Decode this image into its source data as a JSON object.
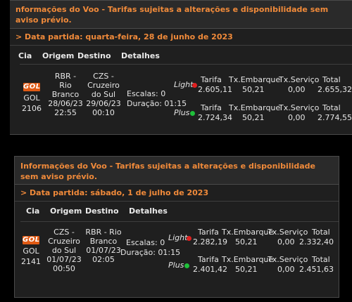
{
  "panels": [
    {
      "header": "nformações do Voo - Tarifas sujeitas a alterações e disponibilidade sem aviso prévio.",
      "date": "> Data partida: quarta-feira, 28 de junho de 2023",
      "columns": {
        "cia": "Cia",
        "origem": "Origem",
        "destino": "Destino",
        "detalhes": "Detalhes"
      },
      "flight": {
        "airline_logo": "GOL",
        "airline": "GOL",
        "number": "2106",
        "origin": [
          "RBR -",
          "Rio",
          "Branco",
          "28/06/23",
          "22:55"
        ],
        "destination": [
          "CZS -",
          "Cruzeiro",
          "do Sul",
          "29/06/23",
          "00:10"
        ],
        "stops": "Escalas: 0",
        "duration": "Duração: 01:15",
        "fare_headers": {
          "tarifa": "Tarifa",
          "embarque": "Tx.Embarque",
          "servico": "Tx.Serviço",
          "total": "Total"
        },
        "fares": [
          {
            "name": "Light",
            "dot_color": "#e02020",
            "tarifa": "2.605,11",
            "embarque": "50,21",
            "servico": "0,00",
            "total": "2.655,32"
          },
          {
            "name": "Plus",
            "dot_color": "#1fbf3a",
            "tarifa": "2.724,34",
            "embarque": "50,21",
            "servico": "0,00",
            "total": "2.774,55"
          }
        ]
      }
    },
    {
      "header": "Informações do Voo - Tarifas sujeitas a alterações e disponibilidade sem aviso prévio.",
      "date": "> Data partida: sábado, 1 de julho de 2023",
      "columns": {
        "cia": "Cia",
        "origem": "Origem",
        "destino": "Destino",
        "detalhes": "Detalhes"
      },
      "flight": {
        "airline_logo": "GOL",
        "airline": "GOL",
        "number": "2141",
        "origin": [
          "CZS -",
          "Cruzeiro",
          "do Sul",
          "01/07/23",
          "00:50"
        ],
        "destination": [
          "RBR - Rio",
          "Branco",
          "01/07/23",
          "02:05"
        ],
        "stops": "Escalas: 0",
        "duration": "Duração: 01:15",
        "fare_headers": {
          "tarifa": "Tarifa",
          "embarque": "Tx.Embarque",
          "servico": "Tx.Serviço",
          "total": "Total"
        },
        "fares": [
          {
            "name": "Light",
            "dot_color": "#e02020",
            "tarifa": "2.282,19",
            "embarque": "50,21",
            "servico": "0,00",
            "total": "2.332,40"
          },
          {
            "name": "Plus",
            "dot_color": "#1fbf3a",
            "tarifa": "2.401,42",
            "embarque": "50,21",
            "servico": "0,00",
            "total": "2.451,63"
          }
        ]
      }
    }
  ]
}
